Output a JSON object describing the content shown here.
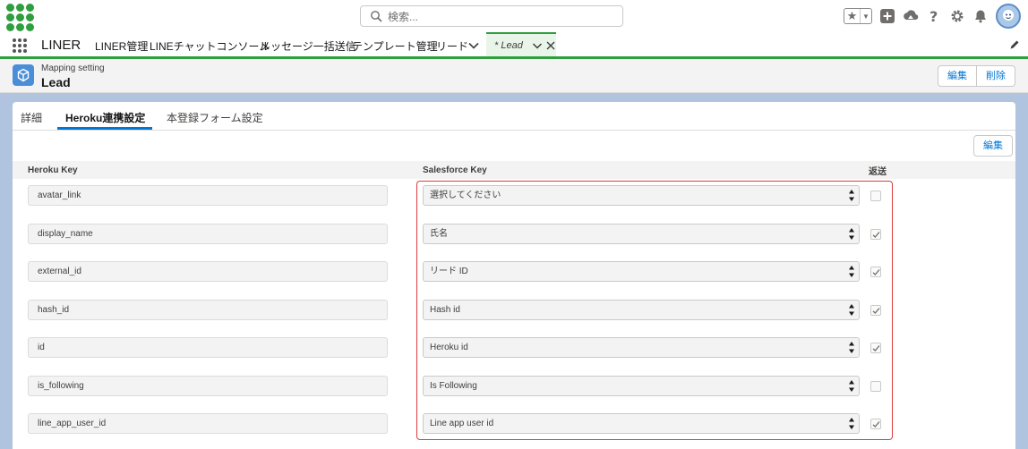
{
  "header": {
    "search_placeholder": "検索...",
    "icons": [
      "favorites-star-icon",
      "add-icon",
      "trailhead-icon",
      "help-icon",
      "setup-gear-icon",
      "notification-bell-icon",
      "user-avatar"
    ]
  },
  "nav": {
    "app_name": "LINER",
    "items": [
      "LINER管理",
      "LINEチャットコンソール",
      "メッセージ一括送信",
      "テンプレート管理",
      "リード"
    ],
    "active_tab": "* Lead"
  },
  "record": {
    "subtitle": "Mapping setting",
    "title": "Lead",
    "edit_label": "編集",
    "delete_label": "削除"
  },
  "tabs": [
    "詳細",
    "Heroku連携設定",
    "本登録フォーム設定"
  ],
  "active_tab_index": 1,
  "card": {
    "edit_label": "編集",
    "columns": {
      "heroku_key": "Heroku Key",
      "salesforce_key": "Salesforce Key",
      "return": "返送"
    },
    "rows": [
      {
        "heroku_key": "avatar_link",
        "salesforce_key": "選択してください",
        "returned": false
      },
      {
        "heroku_key": "display_name",
        "salesforce_key": "氏名",
        "returned": true
      },
      {
        "heroku_key": "external_id",
        "salesforce_key": "リード ID",
        "returned": true
      },
      {
        "heroku_key": "hash_id",
        "salesforce_key": "Hash id",
        "returned": true
      },
      {
        "heroku_key": "id",
        "salesforce_key": "Heroku id",
        "returned": true
      },
      {
        "heroku_key": "is_following",
        "salesforce_key": "Is Following",
        "returned": false
      },
      {
        "heroku_key": "line_app_user_id",
        "salesforce_key": "Line app user id",
        "returned": true
      }
    ]
  },
  "colors": {
    "brand_green": "#2e9e3e",
    "link_blue": "#0176d3",
    "highlight_red": "#e03b3b",
    "page_background": "#b0c4df"
  }
}
